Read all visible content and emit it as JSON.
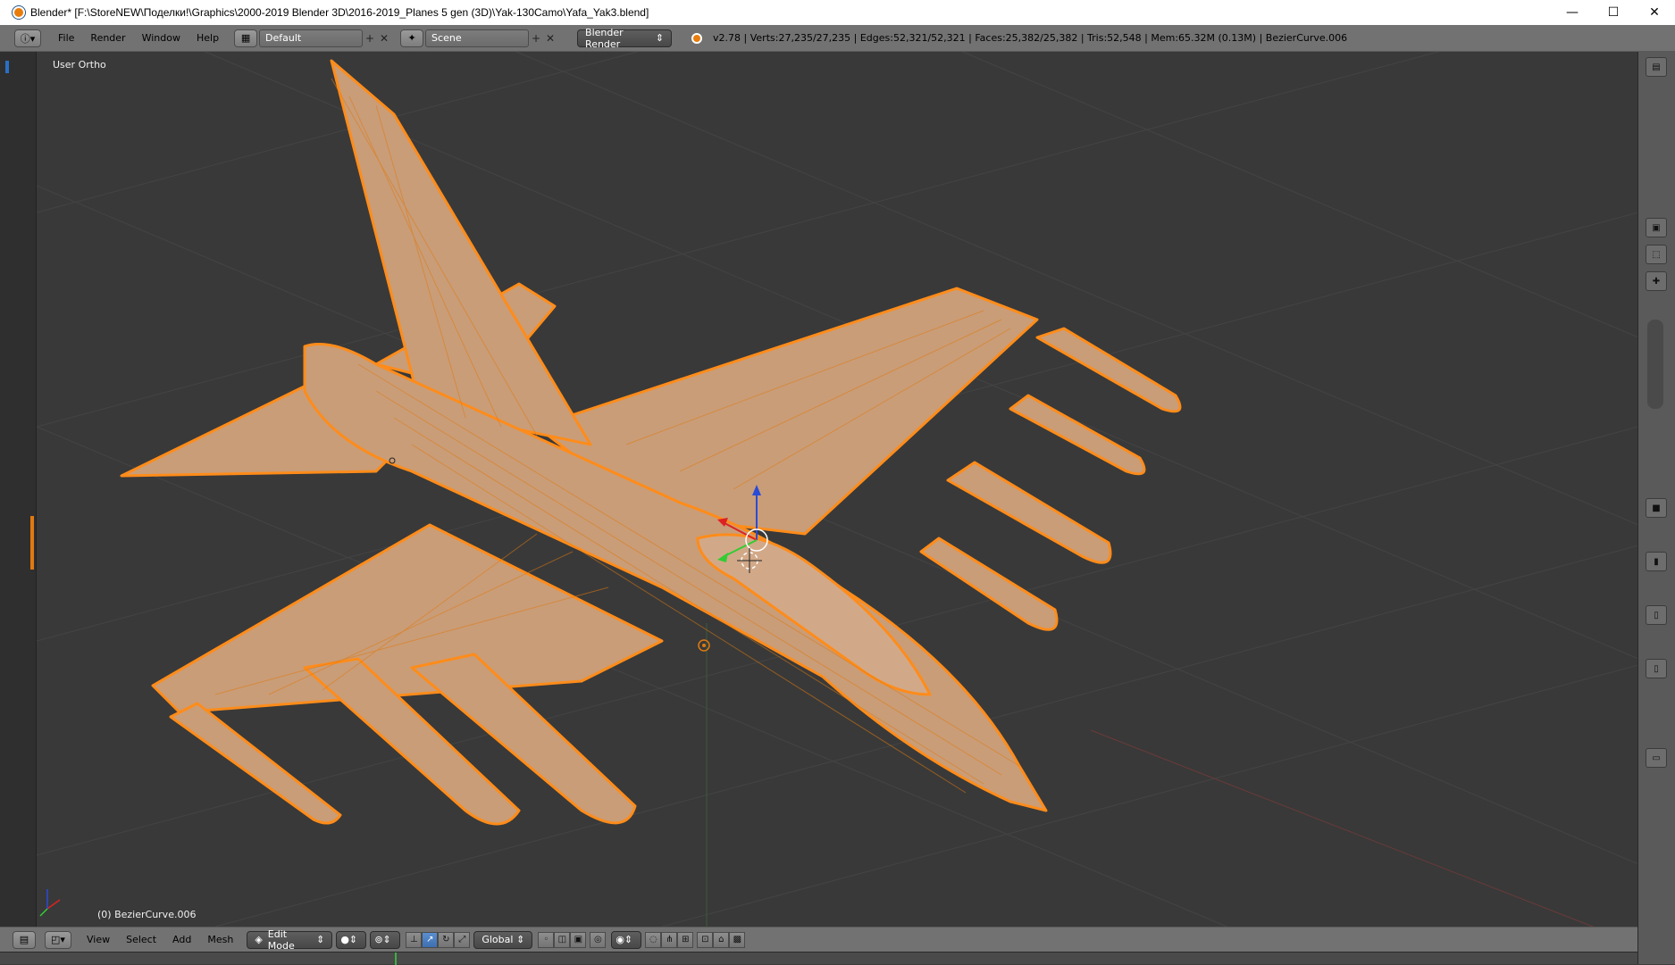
{
  "window": {
    "title": "Blender* [F:\\StoreNEW\\Поделки!\\Graphics\\2000-2019 Blender 3D\\2016-2019_Planes 5 gen (3D)\\Yak-130Camo\\Yafa_Yak3.blend]",
    "minimize": "—",
    "maximize": "☐",
    "close": "✕"
  },
  "info_header": {
    "menu": [
      "File",
      "Render",
      "Window",
      "Help"
    ],
    "layout_name": "Default",
    "scene_name": "Scene",
    "render_engine": "Blender Render",
    "stats": "v2.78 | Verts:27,235/27,235 | Edges:52,321/52,321 | Faces:25,382/25,382 | Tris:52,548 | Mem:65.32M (0.13M) | BezierCurve.006"
  },
  "viewport": {
    "view_name": "User Ortho",
    "active_object": "(0) BezierCurve.006"
  },
  "view3d_header": {
    "menu": [
      "View",
      "Select",
      "Add",
      "Mesh"
    ],
    "mode": "Edit Mode",
    "orientation": "Global"
  },
  "colors": {
    "selection": "#ff8c1a",
    "mesh_face": "#c99d78",
    "background": "#393939"
  }
}
